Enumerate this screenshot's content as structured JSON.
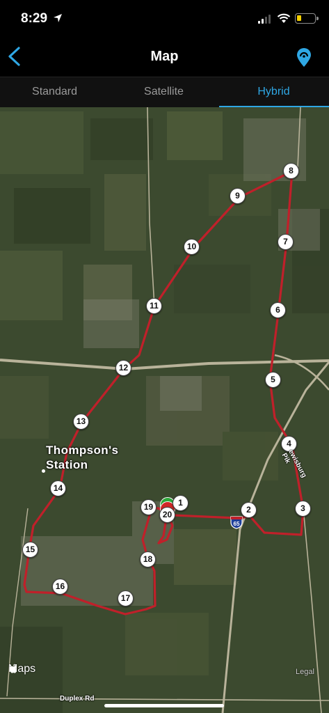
{
  "status_bar": {
    "time": "8:29",
    "battery_color": "#f5d000"
  },
  "nav": {
    "title": "Map",
    "back_icon": "chevron-left-icon",
    "action_icon": "map-pin-icon",
    "accent_color": "#2fa7e4"
  },
  "tabs": [
    {
      "label": "Standard",
      "active": false
    },
    {
      "label": "Satellite",
      "active": false
    },
    {
      "label": "Hybrid",
      "active": true
    }
  ],
  "map": {
    "place_label_line1": "Thompson's",
    "place_label_line2": "Station",
    "road_label_pike": "ewisburg Pik",
    "road_label_duplex": "Duplex Rd",
    "interstate_number": "65",
    "brand": "Maps",
    "legal": "Legal",
    "route_color": "#c0202a",
    "waypoints": [
      "1",
      "2",
      "3",
      "4",
      "5",
      "6",
      "7",
      "8",
      "9",
      "10",
      "11",
      "12",
      "13",
      "14",
      "15",
      "16",
      "17",
      "18",
      "19",
      "20"
    ]
  }
}
